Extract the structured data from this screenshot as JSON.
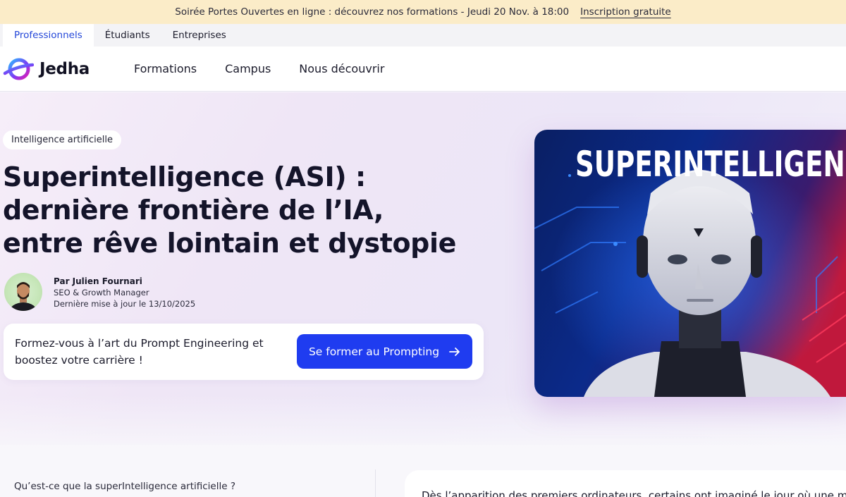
{
  "announcement": {
    "text": "Soirée Portes Ouvertes en ligne : découvrez nos formations - Jeudi 20 Nov. à 18:00",
    "link": "Inscription gratuite"
  },
  "audience_tabs": [
    {
      "label": "Professionnels",
      "active": true
    },
    {
      "label": "Étudiants",
      "active": false
    },
    {
      "label": "Entreprises",
      "active": false
    }
  ],
  "brand": {
    "name": "Jedha"
  },
  "nav": {
    "items": [
      "Formations",
      "Campus",
      "Nous découvrir"
    ]
  },
  "hero": {
    "tag": "Intelligence artificielle",
    "title_lines": [
      "Superintelligence (ASI) :",
      "dernière frontière de l’IA,",
      "entre rêve lointain et dystopie"
    ],
    "author": {
      "name": "Par Julien Fournari",
      "role": "SEO & Growth Manager",
      "updated": "Dernière mise à jour le 13/10/2025"
    },
    "cta": {
      "text": "Formez-vous à l’art du Prompt Engineering et boostez votre carrière !",
      "button": "Se former au Prompting",
      "button_icon": "arrow-right-icon"
    },
    "image_caption": "SUPERINTELLIGENC"
  },
  "toc": {
    "first_item": "Qu’est-ce que la superIntelligence artificielle ?"
  },
  "article": {
    "lead": "Dès l’apparition des premiers ordinateurs, certains ont imaginé le jour où une m"
  },
  "colors": {
    "accent": "#1f3cf0",
    "announce_bg": "#fbecc8",
    "active_tab": "#2346d8"
  }
}
